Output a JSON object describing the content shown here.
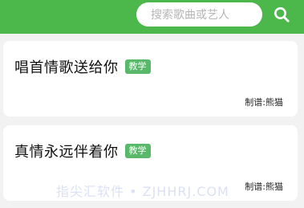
{
  "search": {
    "placeholder": "搜索歌曲或艺人",
    "icon": "search-icon"
  },
  "colors": {
    "header": "#4cb84c",
    "tag": "#59b86a"
  },
  "songs": [
    {
      "title": "唱首情歌送给你",
      "tag": "教学",
      "maker": "制谱:熊猫"
    },
    {
      "title": "真情永远伴着你",
      "tag": "教学",
      "maker": "制谱:熊猫"
    }
  ],
  "watermark": "指尖汇软件 • ZJHHRJ.COM"
}
